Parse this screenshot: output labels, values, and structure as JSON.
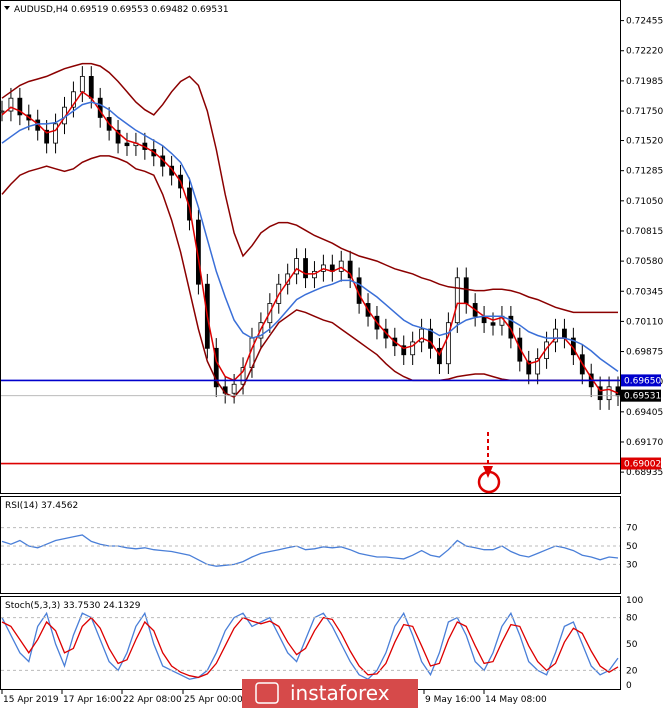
{
  "header": {
    "main": "AUDUSD,H4  0.69519 0.69553 0.69482 0.69531",
    "rsi": "RSI(14) 37.4562",
    "stoch": "Stoch(5,3,3) 33.7530 24.1329"
  },
  "watermark": "instaforex",
  "chart_data": [
    {
      "type": "line",
      "name": "AUDUSD H4 price",
      "title": "AUDUSD,H4",
      "ylim": [
        0.6878,
        0.726
      ],
      "yticks": [
        "0.72455",
        "0.72220",
        "0.71985",
        "0.71750",
        "0.71520",
        "0.71285",
        "0.71050",
        "0.70815",
        "0.70580",
        "0.70345",
        "0.70110",
        "0.69875",
        "0.69640",
        "0.69405",
        "0.69170",
        "0.68935"
      ],
      "xticks": [
        "15 Apr 2019",
        "17 Apr 16:00",
        "22 Apr 08:00",
        "25 Apr 00:00",
        "9 May 16:00",
        "14 May 08:00"
      ],
      "price_tags": {
        "current": "0.69531",
        "resistance": "0.69650",
        "target": "0.69002"
      },
      "levels": [
        {
          "value": 0.6965,
          "color": "#0000cc"
        },
        {
          "value": 0.69002,
          "color": "#dd0000"
        }
      ],
      "series": [
        {
          "color": "#000000",
          "values": [
            0.7175,
            0.7185,
            0.7172,
            0.7168,
            0.716,
            0.715,
            0.7165,
            0.7178,
            0.719,
            0.7202,
            0.7185,
            0.717,
            0.716,
            0.715,
            0.7148,
            0.715,
            0.7145,
            0.714,
            0.7132,
            0.7125,
            0.7115,
            0.709,
            0.704,
            0.699,
            0.696,
            0.6955,
            0.6962,
            0.6975,
            0.6998,
            0.701,
            0.7025,
            0.704,
            0.7048,
            0.706,
            0.7045,
            0.705,
            0.7055,
            0.705,
            0.7058,
            0.7045,
            0.7025,
            0.7015,
            0.7005,
            0.6998,
            0.6992,
            0.6985,
            0.6995,
            0.7005,
            0.699,
            0.6978,
            0.701,
            0.7045,
            0.7025,
            0.7015,
            0.701,
            0.7008,
            0.7015,
            0.6998,
            0.698,
            0.697,
            0.6982,
            0.6995,
            0.7005,
            0.6998,
            0.6985,
            0.697,
            0.696,
            0.695,
            0.696,
            0.6953
          ]
        },
        {
          "color": "#dd0000",
          "values": [
            0.7172,
            0.7178,
            0.7175,
            0.717,
            0.7165,
            0.7158,
            0.716,
            0.717,
            0.718,
            0.719,
            0.7185,
            0.7175,
            0.7165,
            0.7158,
            0.7152,
            0.715,
            0.7147,
            0.7143,
            0.7137,
            0.713,
            0.712,
            0.71,
            0.706,
            0.7015,
            0.698,
            0.6968,
            0.6965,
            0.6972,
            0.699,
            0.7005,
            0.7018,
            0.7032,
            0.7042,
            0.7052,
            0.7048,
            0.7048,
            0.7052,
            0.705,
            0.7053,
            0.7048,
            0.7032,
            0.702,
            0.701,
            0.7002,
            0.6995,
            0.699,
            0.6992,
            0.6998,
            0.6995,
            0.6985,
            0.7,
            0.7025,
            0.7025,
            0.702,
            0.7015,
            0.7012,
            0.7014,
            0.7005,
            0.699,
            0.6978,
            0.698,
            0.699,
            0.6998,
            0.6998,
            0.699,
            0.6978,
            0.6967,
            0.6957,
            0.6958,
            0.6955
          ]
        },
        {
          "color": "#3a6fd8",
          "values": [
            0.715,
            0.7155,
            0.716,
            0.7163,
            0.7165,
            0.7165,
            0.7166,
            0.717,
            0.7175,
            0.718,
            0.7182,
            0.718,
            0.7176,
            0.717,
            0.7165,
            0.716,
            0.7156,
            0.7152,
            0.7148,
            0.7142,
            0.7135,
            0.7122,
            0.71,
            0.7075,
            0.705,
            0.703,
            0.7012,
            0.7002,
            0.6998,
            0.7,
            0.7005,
            0.7012,
            0.702,
            0.7028,
            0.7032,
            0.7035,
            0.7038,
            0.704,
            0.7043,
            0.7043,
            0.704,
            0.7035,
            0.703,
            0.7024,
            0.7018,
            0.7012,
            0.7008,
            0.7006,
            0.7004,
            0.7,
            0.7002,
            0.7008,
            0.7012,
            0.7014,
            0.7015,
            0.7015,
            0.7015,
            0.7012,
            0.7008,
            0.7003,
            0.7,
            0.6998,
            0.6998,
            0.6998,
            0.6996,
            0.6993,
            0.6988,
            0.6982,
            0.6977,
            0.6972
          ]
        },
        {
          "color": "#8b0000",
          "values": [
            0.7185,
            0.719,
            0.7195,
            0.7198,
            0.72,
            0.7202,
            0.7205,
            0.7208,
            0.721,
            0.7212,
            0.7212,
            0.721,
            0.7205,
            0.7198,
            0.719,
            0.7182,
            0.7176,
            0.7172,
            0.718,
            0.719,
            0.7198,
            0.7202,
            0.7195,
            0.7175,
            0.7145,
            0.711,
            0.708,
            0.7062,
            0.707,
            0.708,
            0.7085,
            0.7088,
            0.7088,
            0.7086,
            0.7082,
            0.7078,
            0.7075,
            0.7072,
            0.7068,
            0.7065,
            0.7062,
            0.706,
            0.7058,
            0.7055,
            0.7052,
            0.705,
            0.7048,
            0.7045,
            0.7043,
            0.704,
            0.7038,
            0.7037,
            0.7036,
            0.7035,
            0.7035,
            0.7036,
            0.7036,
            0.7035,
            0.7033,
            0.703,
            0.7028,
            0.7025,
            0.7022,
            0.702,
            0.7018,
            0.7018,
            0.7018,
            0.7018,
            0.7018,
            0.7018
          ]
        },
        {
          "color": "#8b0000",
          "values": [
            0.711,
            0.7118,
            0.7125,
            0.7128,
            0.713,
            0.7132,
            0.713,
            0.7128,
            0.713,
            0.7135,
            0.7138,
            0.714,
            0.714,
            0.7138,
            0.7135,
            0.713,
            0.7128,
            0.7125,
            0.711,
            0.709,
            0.7065,
            0.7035,
            0.7005,
            0.698,
            0.6965,
            0.6955,
            0.6952,
            0.696,
            0.6975,
            0.699,
            0.7,
            0.701,
            0.7015,
            0.702,
            0.7018,
            0.7015,
            0.7012,
            0.701,
            0.7005,
            0.7,
            0.6995,
            0.699,
            0.6985,
            0.6978,
            0.6972,
            0.6968,
            0.6965,
            0.6965,
            0.6965,
            0.6965,
            0.6966,
            0.6968,
            0.6969,
            0.697,
            0.697,
            0.6968,
            0.6966,
            0.6965,
            0.6965,
            0.6965,
            0.6965,
            0.6965,
            0.6965,
            0.6965,
            0.6965,
            0.6965,
            0.6965,
            0.6965,
            0.6965,
            0.6965
          ]
        }
      ]
    },
    {
      "type": "line",
      "name": "RSI(14)",
      "ylim": [
        0,
        100
      ],
      "yticks": [
        "70",
        "50",
        "30"
      ],
      "series": [
        {
          "color": "#4a7fd8",
          "values": [
            55,
            52,
            56,
            50,
            48,
            52,
            56,
            58,
            60,
            62,
            55,
            52,
            50,
            50,
            48,
            47,
            48,
            46,
            45,
            44,
            42,
            40,
            35,
            30,
            28,
            29,
            30,
            33,
            38,
            42,
            44,
            46,
            48,
            50,
            46,
            47,
            49,
            48,
            49,
            46,
            42,
            40,
            38,
            38,
            37,
            36,
            40,
            45,
            40,
            38,
            46,
            56,
            50,
            48,
            46,
            46,
            50,
            44,
            40,
            38,
            42,
            46,
            50,
            48,
            45,
            40,
            38,
            35,
            38,
            37
          ]
        }
      ]
    },
    {
      "type": "line",
      "name": "Stoch(5,3,3)",
      "ylim": [
        0,
        100
      ],
      "yticks": [
        "100",
        "80",
        "50",
        "20",
        "0"
      ],
      "series": [
        {
          "color": "#4a7fd8",
          "values": [
            80,
            60,
            40,
            30,
            70,
            85,
            50,
            25,
            60,
            85,
            80,
            55,
            30,
            20,
            40,
            70,
            85,
            50,
            25,
            20,
            15,
            10,
            12,
            20,
            40,
            65,
            80,
            85,
            70,
            75,
            80,
            60,
            40,
            30,
            55,
            80,
            85,
            70,
            50,
            30,
            15,
            10,
            20,
            40,
            70,
            85,
            60,
            30,
            15,
            40,
            75,
            80,
            60,
            30,
            20,
            40,
            70,
            85,
            60,
            30,
            20,
            15,
            40,
            70,
            75,
            50,
            25,
            15,
            20,
            34
          ]
        },
        {
          "color": "#dd0000",
          "values": [
            75,
            70,
            55,
            40,
            55,
            75,
            65,
            40,
            45,
            70,
            80,
            68,
            45,
            28,
            32,
            55,
            75,
            65,
            40,
            25,
            18,
            14,
            12,
            16,
            28,
            48,
            68,
            80,
            76,
            73,
            76,
            70,
            52,
            38,
            45,
            65,
            80,
            78,
            62,
            42,
            25,
            15,
            16,
            28,
            52,
            72,
            70,
            48,
            25,
            28,
            55,
            75,
            70,
            48,
            28,
            30,
            52,
            72,
            70,
            48,
            30,
            20,
            28,
            52,
            68,
            62,
            42,
            25,
            18,
            24
          ]
        }
      ]
    }
  ]
}
